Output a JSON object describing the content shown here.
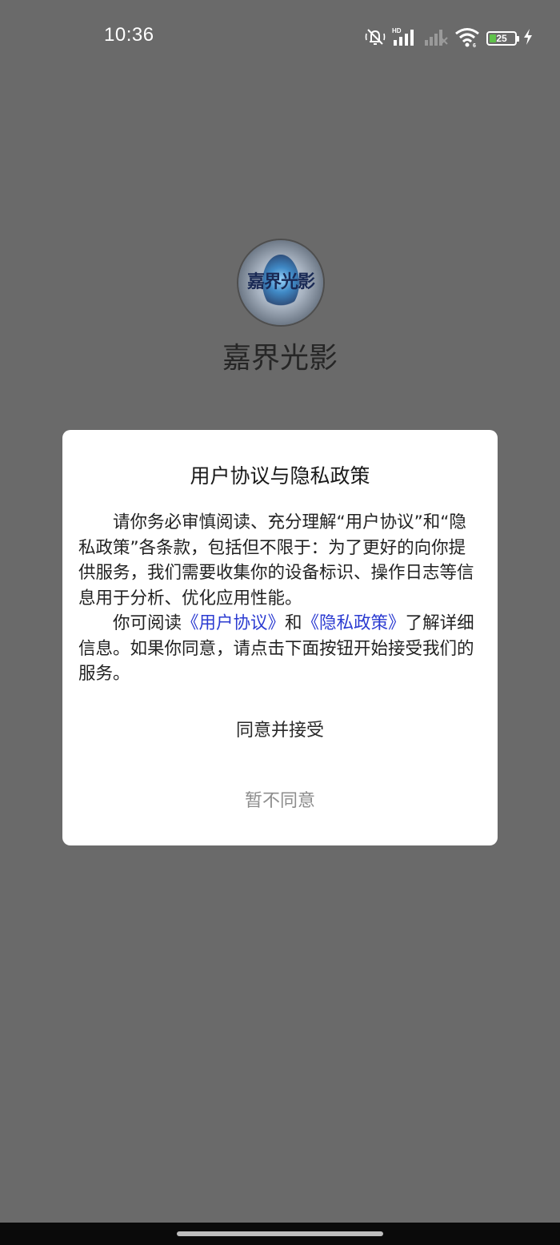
{
  "status_bar": {
    "time": "10:36",
    "battery_level": 25,
    "battery_label": "25",
    "icons": [
      "mute-vibrate-icon",
      "hd-signal-icon",
      "signal-off-icon",
      "wifi-icon",
      "battery-icon",
      "charging-icon"
    ]
  },
  "splash": {
    "logo_text": "嘉界光影",
    "app_name": "嘉界光影"
  },
  "dialog": {
    "title": "用户协议与隐私政策",
    "paragraph1": "请你务必审慎阅读、充分理解“用户协议”和“隐私政策”各条款，包括但不限于：为了更好的向你提供服务，我们需要收集你的设备标识、操作日志等信息用于分析、优化应用性能。",
    "p2_prefix": "你可阅读",
    "user_agreement_link": "《用户协议》",
    "p2_and": "和",
    "privacy_policy_link": "《隐私政策》",
    "p2_suffix": "了解详细信息。如果你同意，请点击下面按钮开始接受我们的服务。",
    "agree_label": "同意并接受",
    "disagree_label": "暂不同意"
  },
  "colors": {
    "overlay_background": "#6a6a6a",
    "dialog_background": "#ffffff",
    "link": "#2b3bd1",
    "battery_fill": "#5fc24a"
  }
}
